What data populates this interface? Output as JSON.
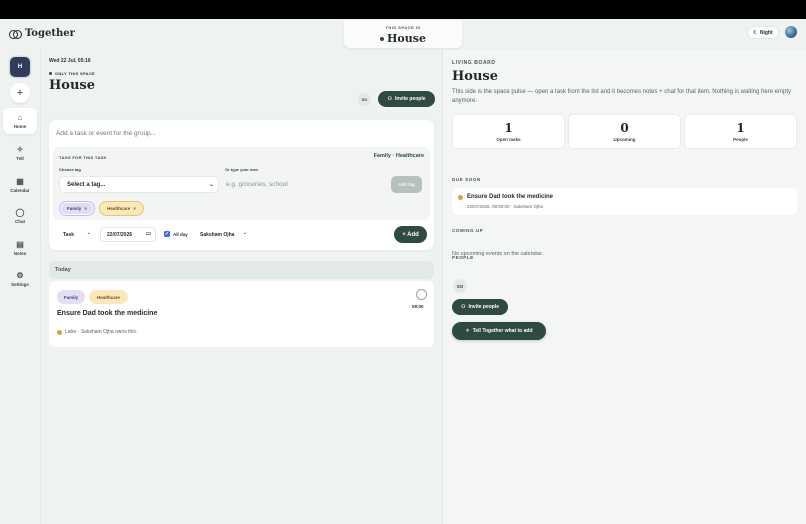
{
  "brand": {
    "name": "Together"
  },
  "space_card": {
    "kicker": "THIS SPACE IS",
    "title": "House"
  },
  "header": {
    "night_label": "Night"
  },
  "rail": {
    "avatar_letter": "H",
    "add_symbol": "+",
    "items": [
      {
        "label": "Home",
        "icon": "home-icon",
        "glyph": "⌂",
        "active": true
      },
      {
        "label": "Tell",
        "icon": "sparkle-icon",
        "glyph": "✧",
        "active": false
      },
      {
        "label": "Calendar",
        "icon": "calendar-icon",
        "glyph": "▦",
        "active": false
      },
      {
        "label": "Chat",
        "icon": "chat-icon",
        "glyph": "◯",
        "active": false
      },
      {
        "label": "Notes",
        "icon": "notes-icon",
        "glyph": "▤",
        "active": false
      },
      {
        "label": "Settings",
        "icon": "gear-icon",
        "glyph": "⚙",
        "active": false
      }
    ]
  },
  "main": {
    "date": "Wed 22 Jul, 05:16",
    "only_space": "ONLY THIS SPACE",
    "title": "House",
    "member_initials": "SO",
    "invite_label": "Invite people",
    "compose": {
      "placeholder": "Add a task or event for the group...",
      "tags_header": "TAGS FOR THIS TASK",
      "selected_tags": "Family · Healthcare",
      "choose_label": "Choose tag",
      "own_label": "Or type your own",
      "select_value": "Select a tag...",
      "own_placeholder": "e.g. groceries, school",
      "add_tag_label": "Add tag",
      "chips": [
        {
          "label": "Family",
          "remove": "×"
        },
        {
          "label": "Healthcare",
          "remove": "×"
        }
      ],
      "type_value": "Task",
      "date_value": "22/07/2026",
      "allday_label": "All day",
      "owner_value": "Saksham Ojha",
      "add_label": "+ Add"
    },
    "today_label": "Today",
    "task": {
      "tags": [
        "Family",
        "Healthcare"
      ],
      "title": "Ensure Dad took the medicine",
      "time": "09:00",
      "meta": "Later · Saksham Ojha owns this."
    }
  },
  "board": {
    "kicker": "LIVING BOARD",
    "title": "House",
    "description": "This side is the space pulse — open a task from the list and it becomes notes + chat for that item. Nothing is waiting here empty anymore.",
    "stats": [
      {
        "value": "1",
        "label": "Open tasks"
      },
      {
        "value": "0",
        "label": "Upcoming"
      },
      {
        "value": "1",
        "label": "People"
      }
    ],
    "due_soon_header": "DUE SOON",
    "due_item": {
      "title": "Ensure Dad took the medicine",
      "meta": "22/07/2026, 09:00:00 · Saksham Ojha"
    },
    "coming_up_header": "COMING UP",
    "no_events": "No upcoming events on the calendar.",
    "people_header": "PEOPLE",
    "people_initials": "SO",
    "invite_label": "Invite people",
    "tell_label": "Tell Together what to add"
  },
  "colors": {
    "accent": "#2f4a42",
    "family_chip": "#e2dcf4",
    "healthcare_chip": "#fbe8b9",
    "due_dot": "#d6a53e"
  }
}
